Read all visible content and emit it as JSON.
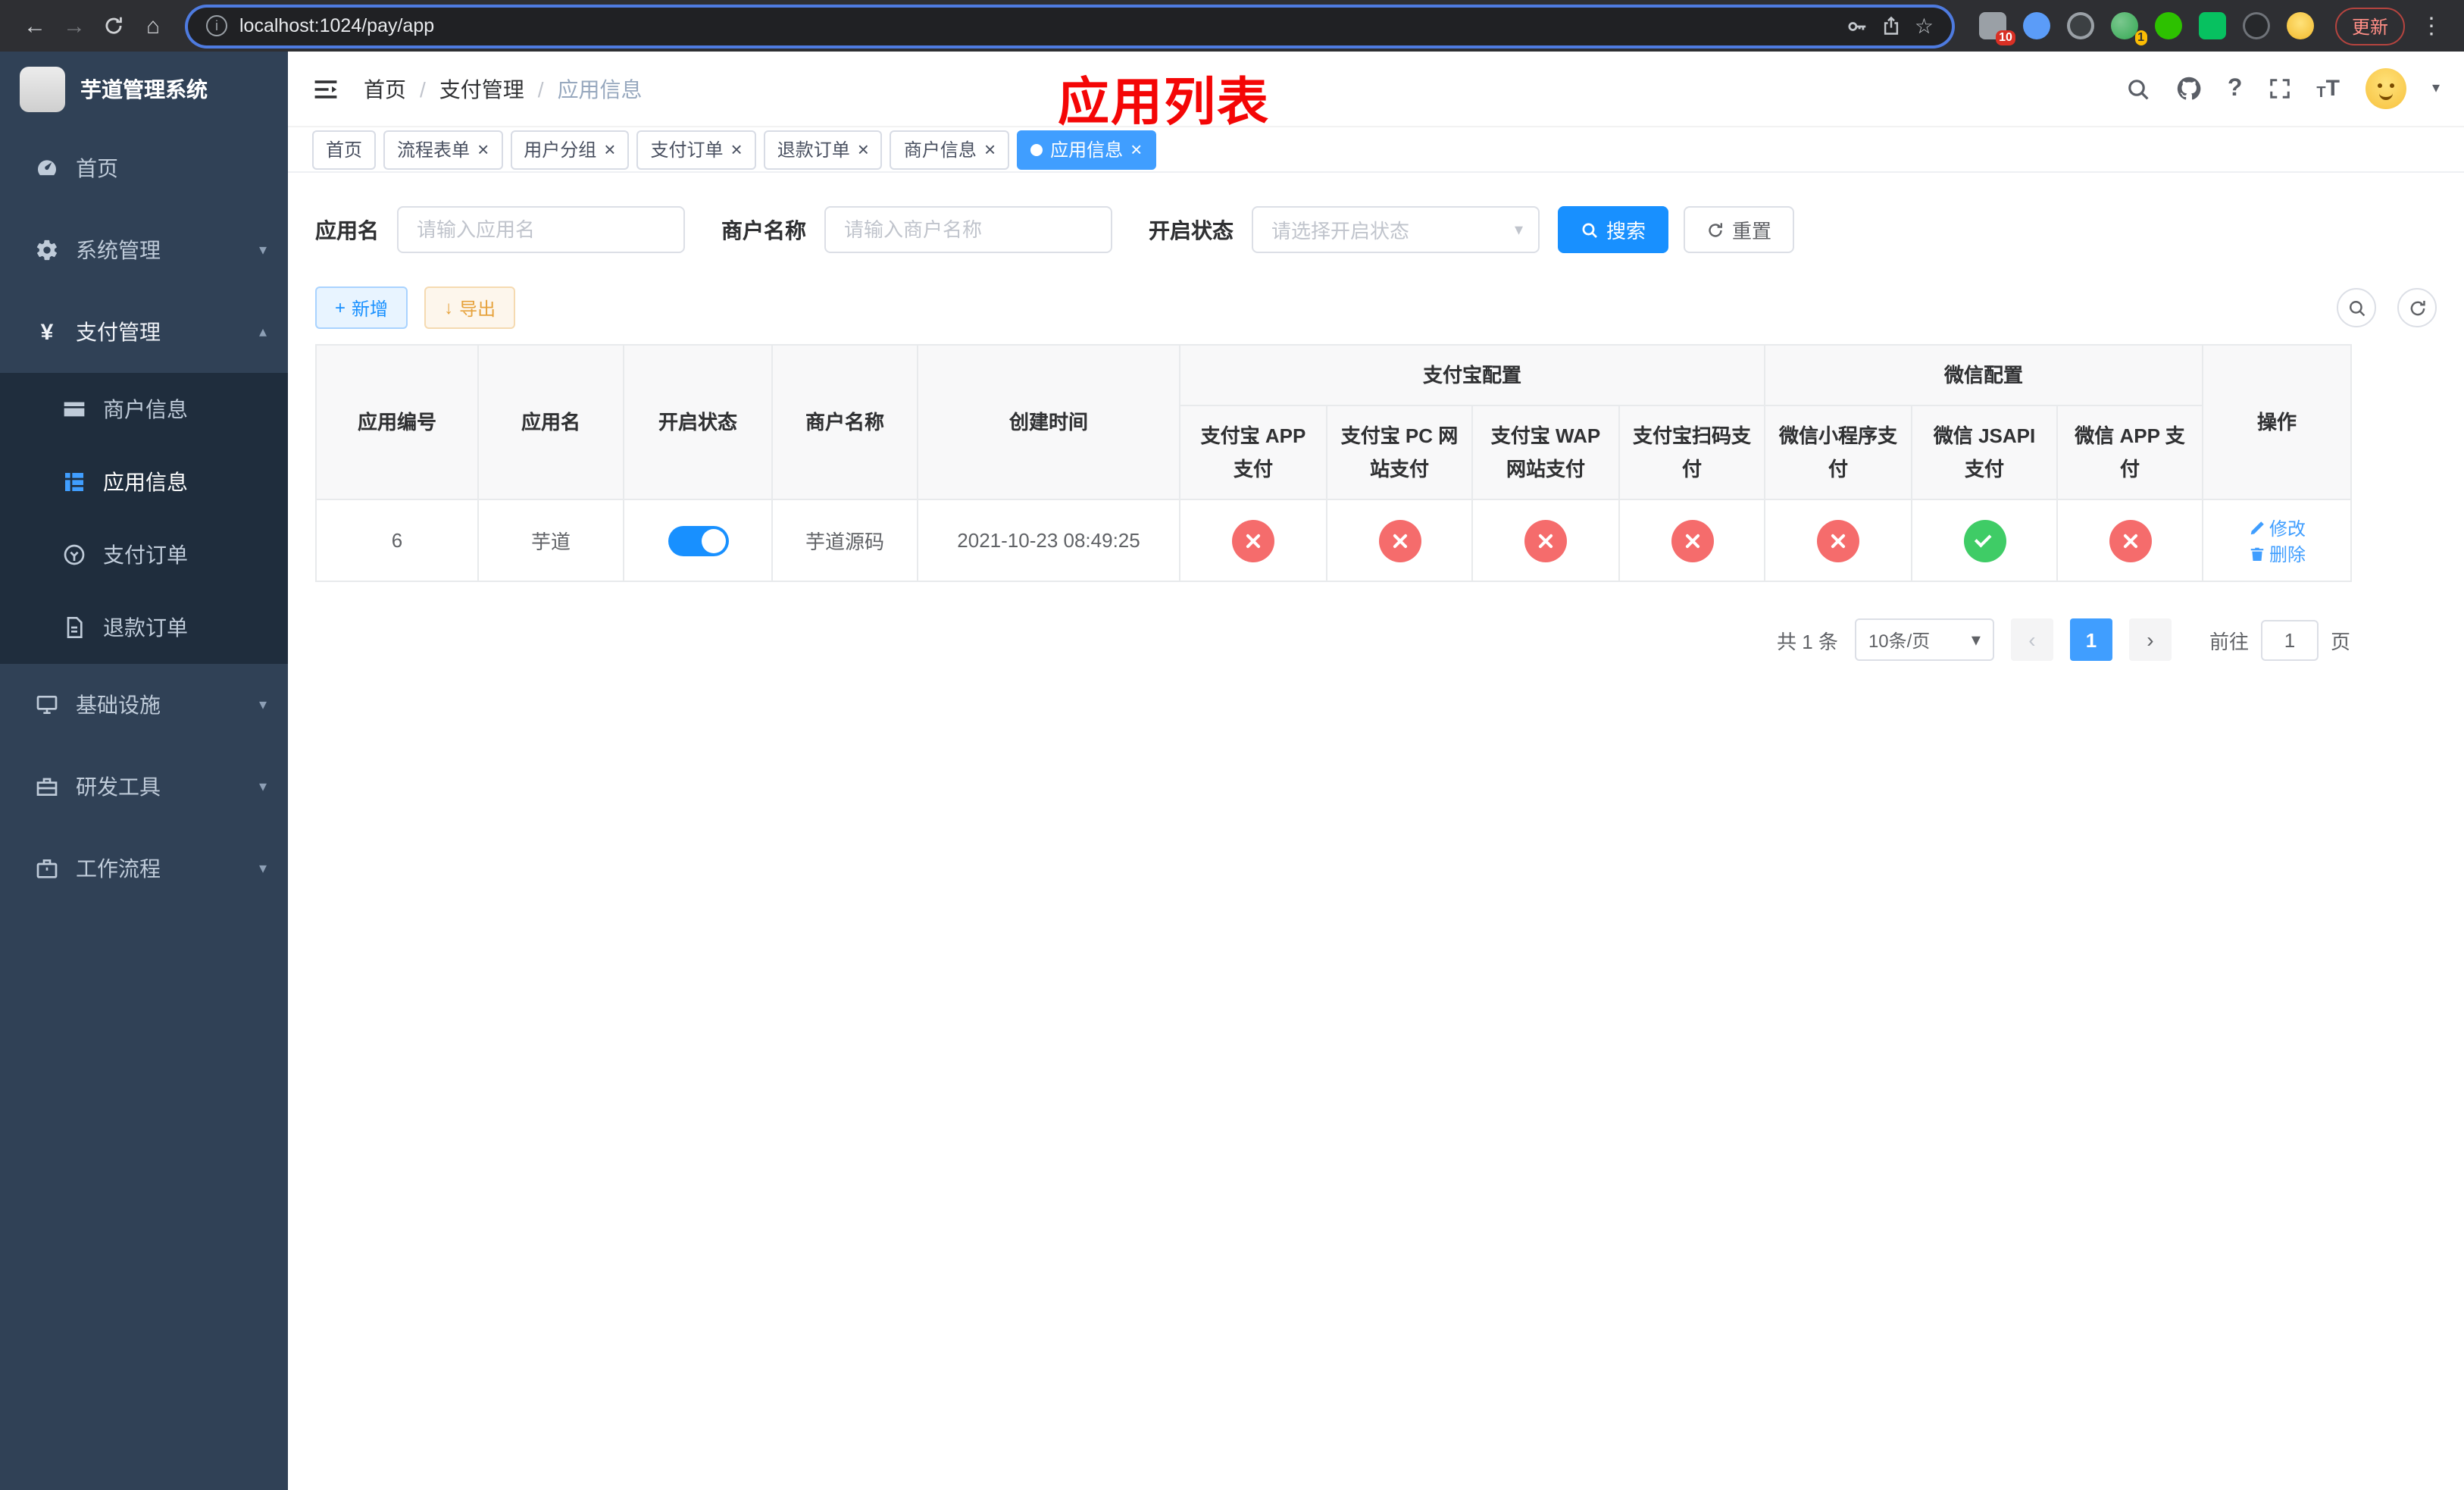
{
  "colors": {
    "primary": "#409eff",
    "search_blue": "#1890ff",
    "danger_red": "#f56c6c",
    "success_green": "#3fcc66",
    "warning_orange": "#e6a23c",
    "annotation_red": "#f40606",
    "sidebar_bg": "#304156",
    "sidebar_submenu_bg": "#1f2d3d"
  },
  "browser": {
    "url": "localhost:1024/pay/app",
    "update_label": "更新",
    "extension_badge": "10",
    "profile_badge": "1"
  },
  "icons": {
    "back": "←",
    "forward": "→",
    "home": "⌂",
    "star": "☆",
    "dots": "⋮",
    "info": "i",
    "question": "?",
    "caret_down": "▾",
    "chevron_down": "▾",
    "chevron_up": "▴",
    "close": "×",
    "plus": "+",
    "download": "↓",
    "prev_arrow": "‹",
    "next_arrow": "›",
    "breadcrumb_separator": "/",
    "yen": "¥"
  },
  "sidebar": {
    "title": "芋道管理系统",
    "items": {
      "home": "首页",
      "system": "系统管理",
      "payment": "支付管理",
      "merchant_info": "商户信息",
      "app_info": "应用信息",
      "pay_orders": "支付订单",
      "refund_orders": "退款订单",
      "infrastructure": "基础设施",
      "dev_tools": "研发工具",
      "workflow": "工作流程"
    }
  },
  "header": {
    "breadcrumb": [
      "首页",
      "支付管理",
      "应用信息"
    ],
    "annotation_title": "应用列表"
  },
  "tabs": [
    {
      "label": "首页"
    },
    {
      "label": "流程表单"
    },
    {
      "label": "用户分组"
    },
    {
      "label": "支付订单"
    },
    {
      "label": "退款订单"
    },
    {
      "label": "商户信息"
    },
    {
      "label": "应用信息"
    }
  ],
  "filters": {
    "app_name_label": "应用名",
    "app_name_placeholder": "请输入应用名",
    "merchant_label": "商户名称",
    "merchant_placeholder": "请输入商户名称",
    "status_label": "开启状态",
    "status_placeholder": "请选择开启状态",
    "search_label": "搜索",
    "reset_label": "重置"
  },
  "toolbar": {
    "add_label": "新增",
    "export_label": "导出"
  },
  "table": {
    "headers": {
      "app_id": "应用编号",
      "app_name": "应用名",
      "status": "开启状态",
      "merchant_name": "商户名称",
      "created_at": "创建时间",
      "alipay_group": "支付宝配置",
      "wechat_group": "微信配置",
      "alipay_app": "支付宝 APP 支付",
      "alipay_pc": "支付宝 PC 网站支付",
      "alipay_wap": "支付宝 WAP 网站支付",
      "alipay_qr": "支付宝扫码支付",
      "wechat_mini": "微信小程序支付",
      "wechat_jsapi": "微信 JSAPI 支付",
      "wechat_app": "微信 APP 支付",
      "actions": "操作"
    },
    "rows": [
      {
        "app_id": "6",
        "app_name": "芋道",
        "status_on": true,
        "merchant_name": "芋道源码",
        "created_at": "2021-10-23 08:49:25",
        "configs": [
          "disabled",
          "disabled",
          "disabled",
          "disabled",
          "disabled",
          "enabled",
          "disabled"
        ],
        "edit_label": "修改",
        "delete_label": "删除"
      }
    ]
  },
  "pagination": {
    "total": "共 1 条",
    "page_size": "10条/页",
    "current_page": "1",
    "goto_label": "前往",
    "goto_value": "1",
    "page_unit": "页"
  }
}
